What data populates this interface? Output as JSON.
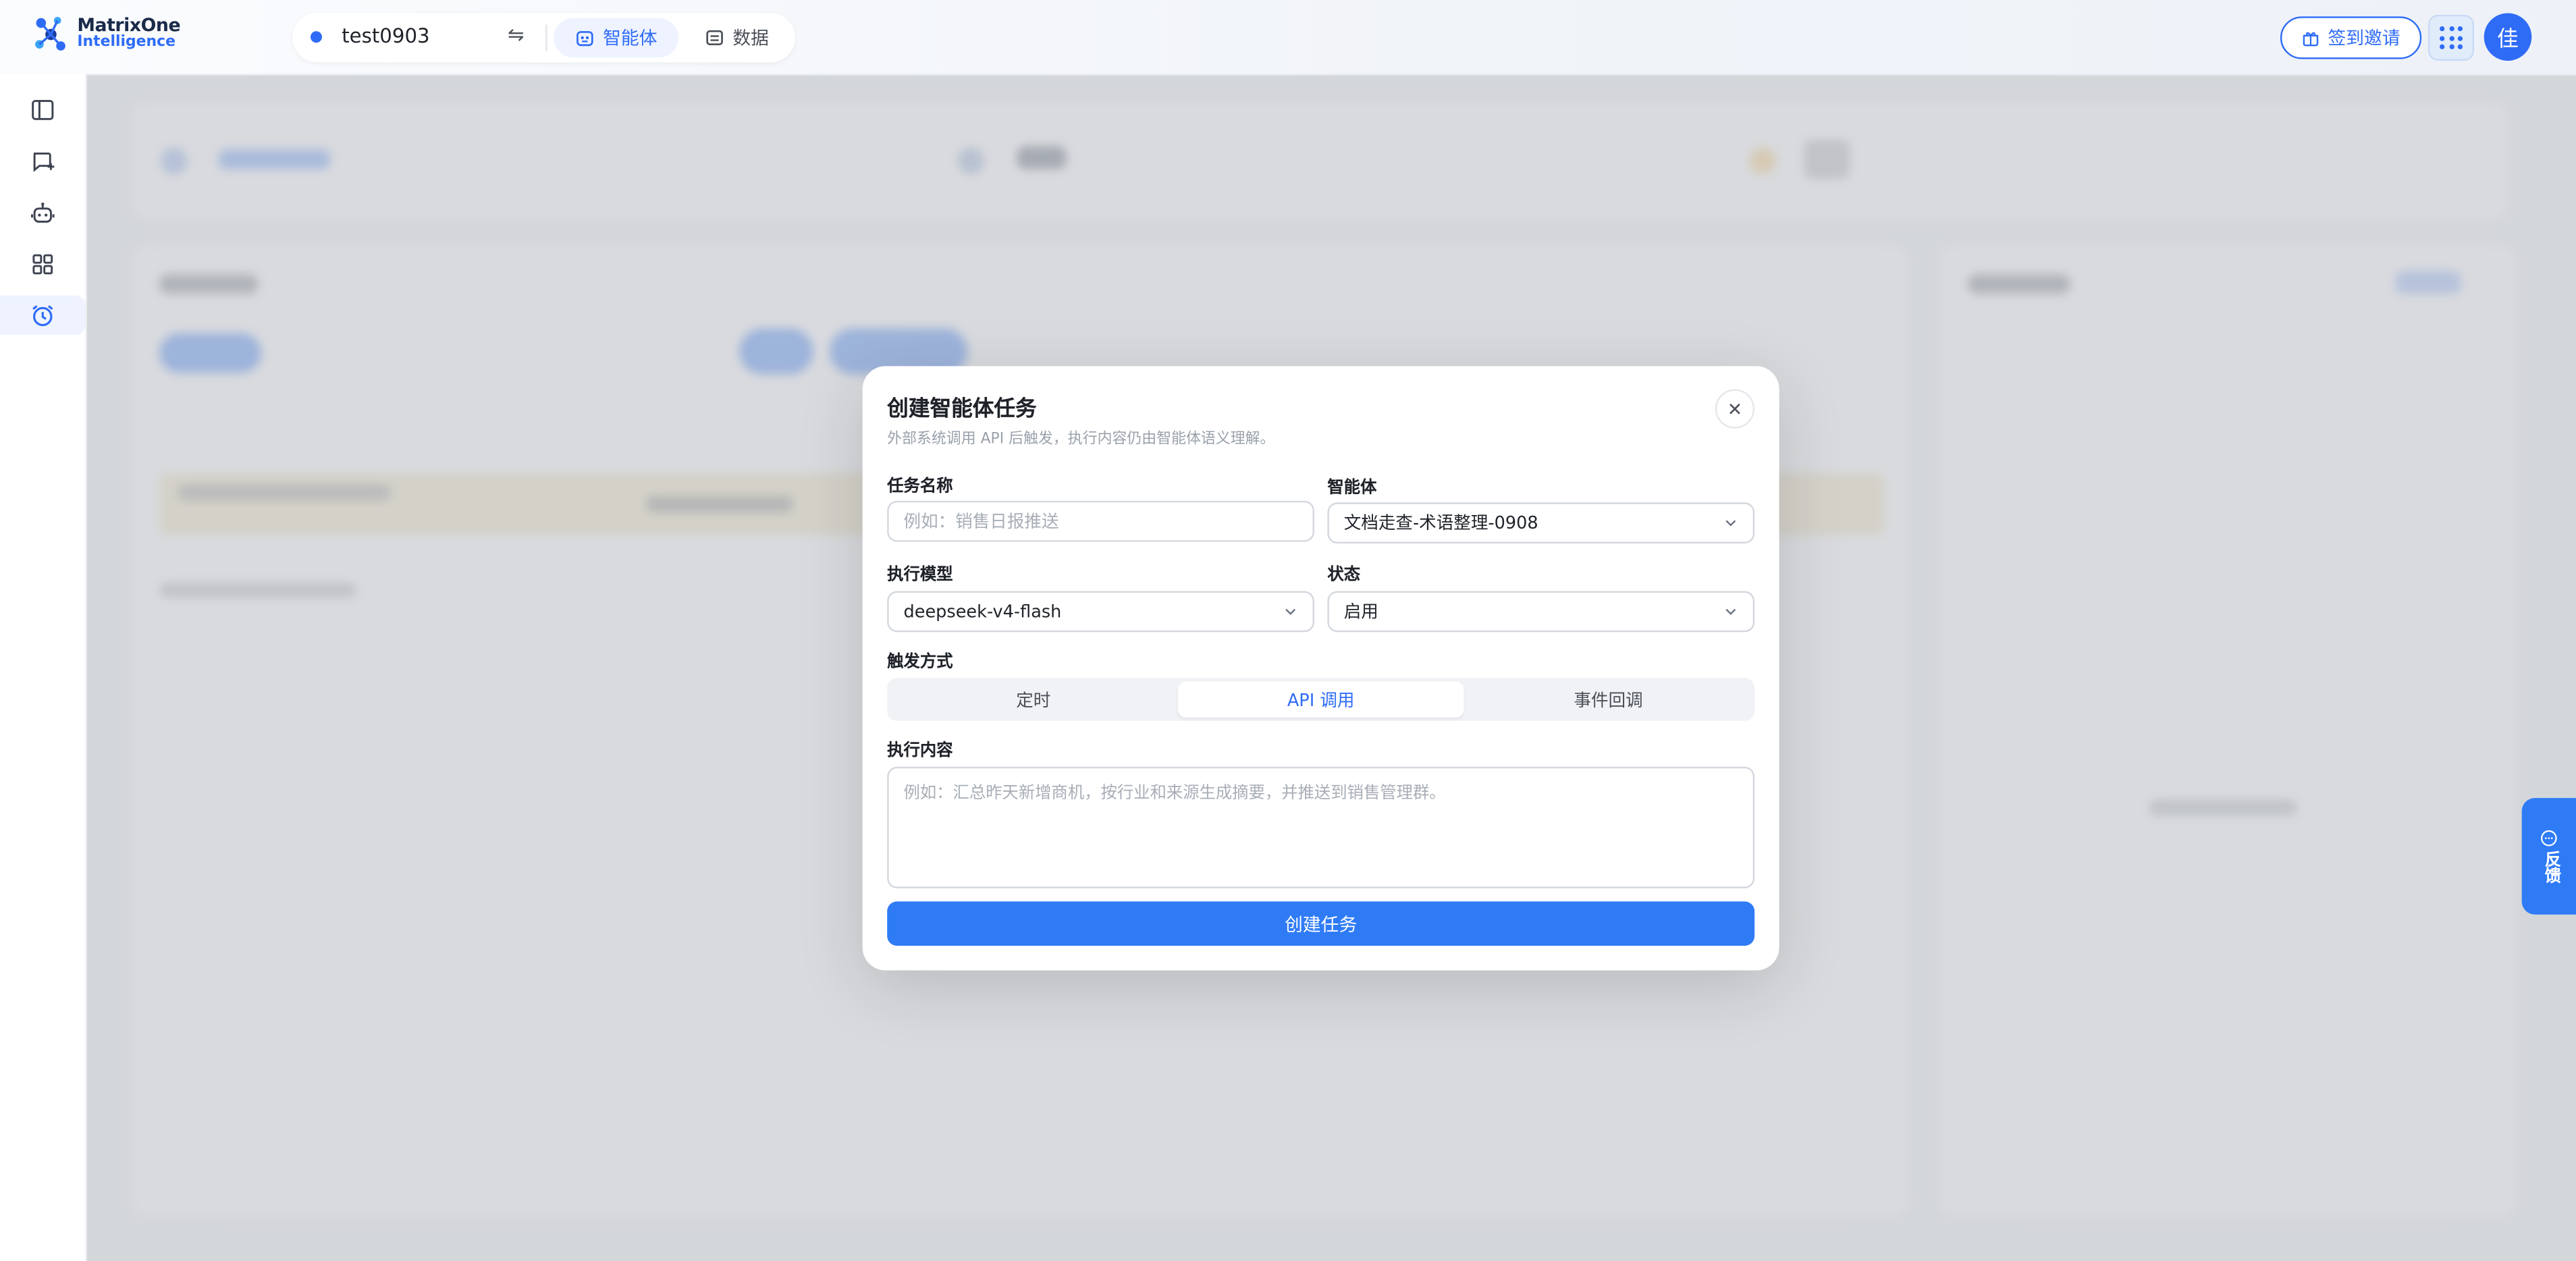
{
  "brand": {
    "line1": "MatrixOne",
    "line2": "Intelligence"
  },
  "workspace": {
    "name": "test0903",
    "swap_icon": "swap-icon"
  },
  "tabs": [
    {
      "label": "智能体",
      "icon": "robot-icon",
      "active": true
    },
    {
      "label": "数据",
      "icon": "data-icon",
      "active": false
    }
  ],
  "header": {
    "invite_label": "签到邀请",
    "avatar_char": "佳"
  },
  "sidebar": {
    "items": [
      {
        "icon": "panel-toggle-icon"
      },
      {
        "icon": "new-chat-icon"
      },
      {
        "icon": "agent-icon"
      },
      {
        "icon": "apps-grid-icon"
      },
      {
        "icon": "alarm-clock-icon",
        "active": true
      }
    ]
  },
  "feedback": {
    "label": "反馈"
  },
  "modal": {
    "title": "创建智能体任务",
    "subtitle": "外部系统调用 API 后触发，执行内容仍由智能体语义理解。",
    "task_name": {
      "label": "任务名称",
      "placeholder": "例如：销售日报推送"
    },
    "agent": {
      "label": "智能体",
      "value": "文档走查-术语整理-0908"
    },
    "model": {
      "label": "执行模型",
      "value": "deepseek-v4-flash"
    },
    "status": {
      "label": "状态",
      "value": "启用"
    },
    "trigger": {
      "label": "触发方式",
      "options": [
        "定时",
        "API 调用",
        "事件回调"
      ],
      "selected": "API 调用"
    },
    "content": {
      "label": "执行内容",
      "placeholder": "例如：汇总昨天新增商机，按行业和来源生成摘要，并推送到销售管理群。"
    },
    "submit_label": "创建任务"
  },
  "colors": {
    "accent": "#2f6cf6",
    "button": "#2f7bf6"
  }
}
